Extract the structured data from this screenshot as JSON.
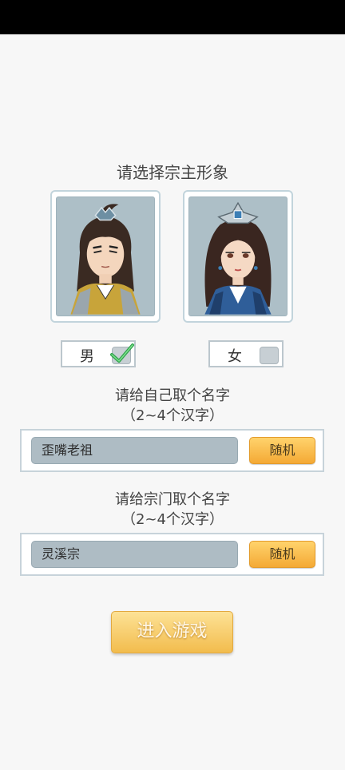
{
  "header": {
    "title": "请选择宗主形象"
  },
  "avatars": {
    "male": {
      "label": "男",
      "checked": true
    },
    "female": {
      "label": "女",
      "checked": false
    }
  },
  "self_name": {
    "prompt": "请给自己取个名字",
    "hint": "（2~4个汉字）",
    "value": "歪嘴老祖",
    "random_label": "随机"
  },
  "sect_name": {
    "prompt": "请给宗门取个名字",
    "hint": "（2~4个汉字）",
    "value": "灵溪宗",
    "random_label": "随机"
  },
  "enter_button": {
    "label": "进入游戏"
  },
  "colors": {
    "accent": "#f4a935",
    "panel_border": "#c7d3da",
    "input_bg": "#aebcc4"
  }
}
